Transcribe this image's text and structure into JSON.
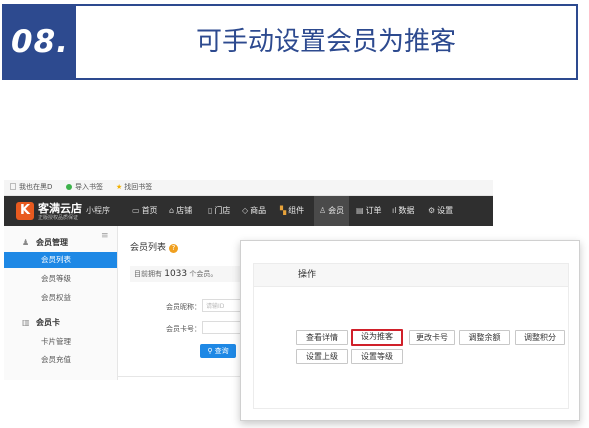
{
  "banner": {
    "number": "08.",
    "title": "可手动设置会员为推客"
  },
  "bookmarks": [
    "我也在黑D",
    "导入书签",
    "找回书签"
  ],
  "nav": {
    "logo_letter": "K",
    "logo_name": "客满云店",
    "logo_sub": "正版授权品质保证",
    "logo_mini": "小程序",
    "items": [
      "首页",
      "店铺",
      "门店",
      "商品",
      "组件",
      "会员",
      "订单",
      "数据",
      "设置"
    ]
  },
  "sidebar": {
    "group1": "会员管理",
    "items1": [
      "会员列表",
      "会员等级",
      "会员权益"
    ],
    "group2": "会员卡",
    "items2": [
      "卡片管理",
      "会员充值"
    ]
  },
  "main": {
    "title": "会员列表",
    "count_prefix": "目前拥有",
    "count_value": "1033",
    "count_suffix": "个会员。",
    "label_nick": "会员昵称：",
    "placeholder_nick": "请输ID",
    "label_card": "会员卡号：",
    "query_btn": "查询"
  },
  "popup": {
    "header": "操作",
    "buttons": [
      "查看详情",
      "设为推客",
      "更改卡号",
      "调整余额",
      "调整积分",
      "设置上级",
      "设置等级"
    ]
  },
  "colors": {
    "brand_blue": "#2d4a8f",
    "accent_blue": "#1e88e5",
    "logo_orange": "#e85a1f",
    "highlight_red": "#d0202a"
  }
}
